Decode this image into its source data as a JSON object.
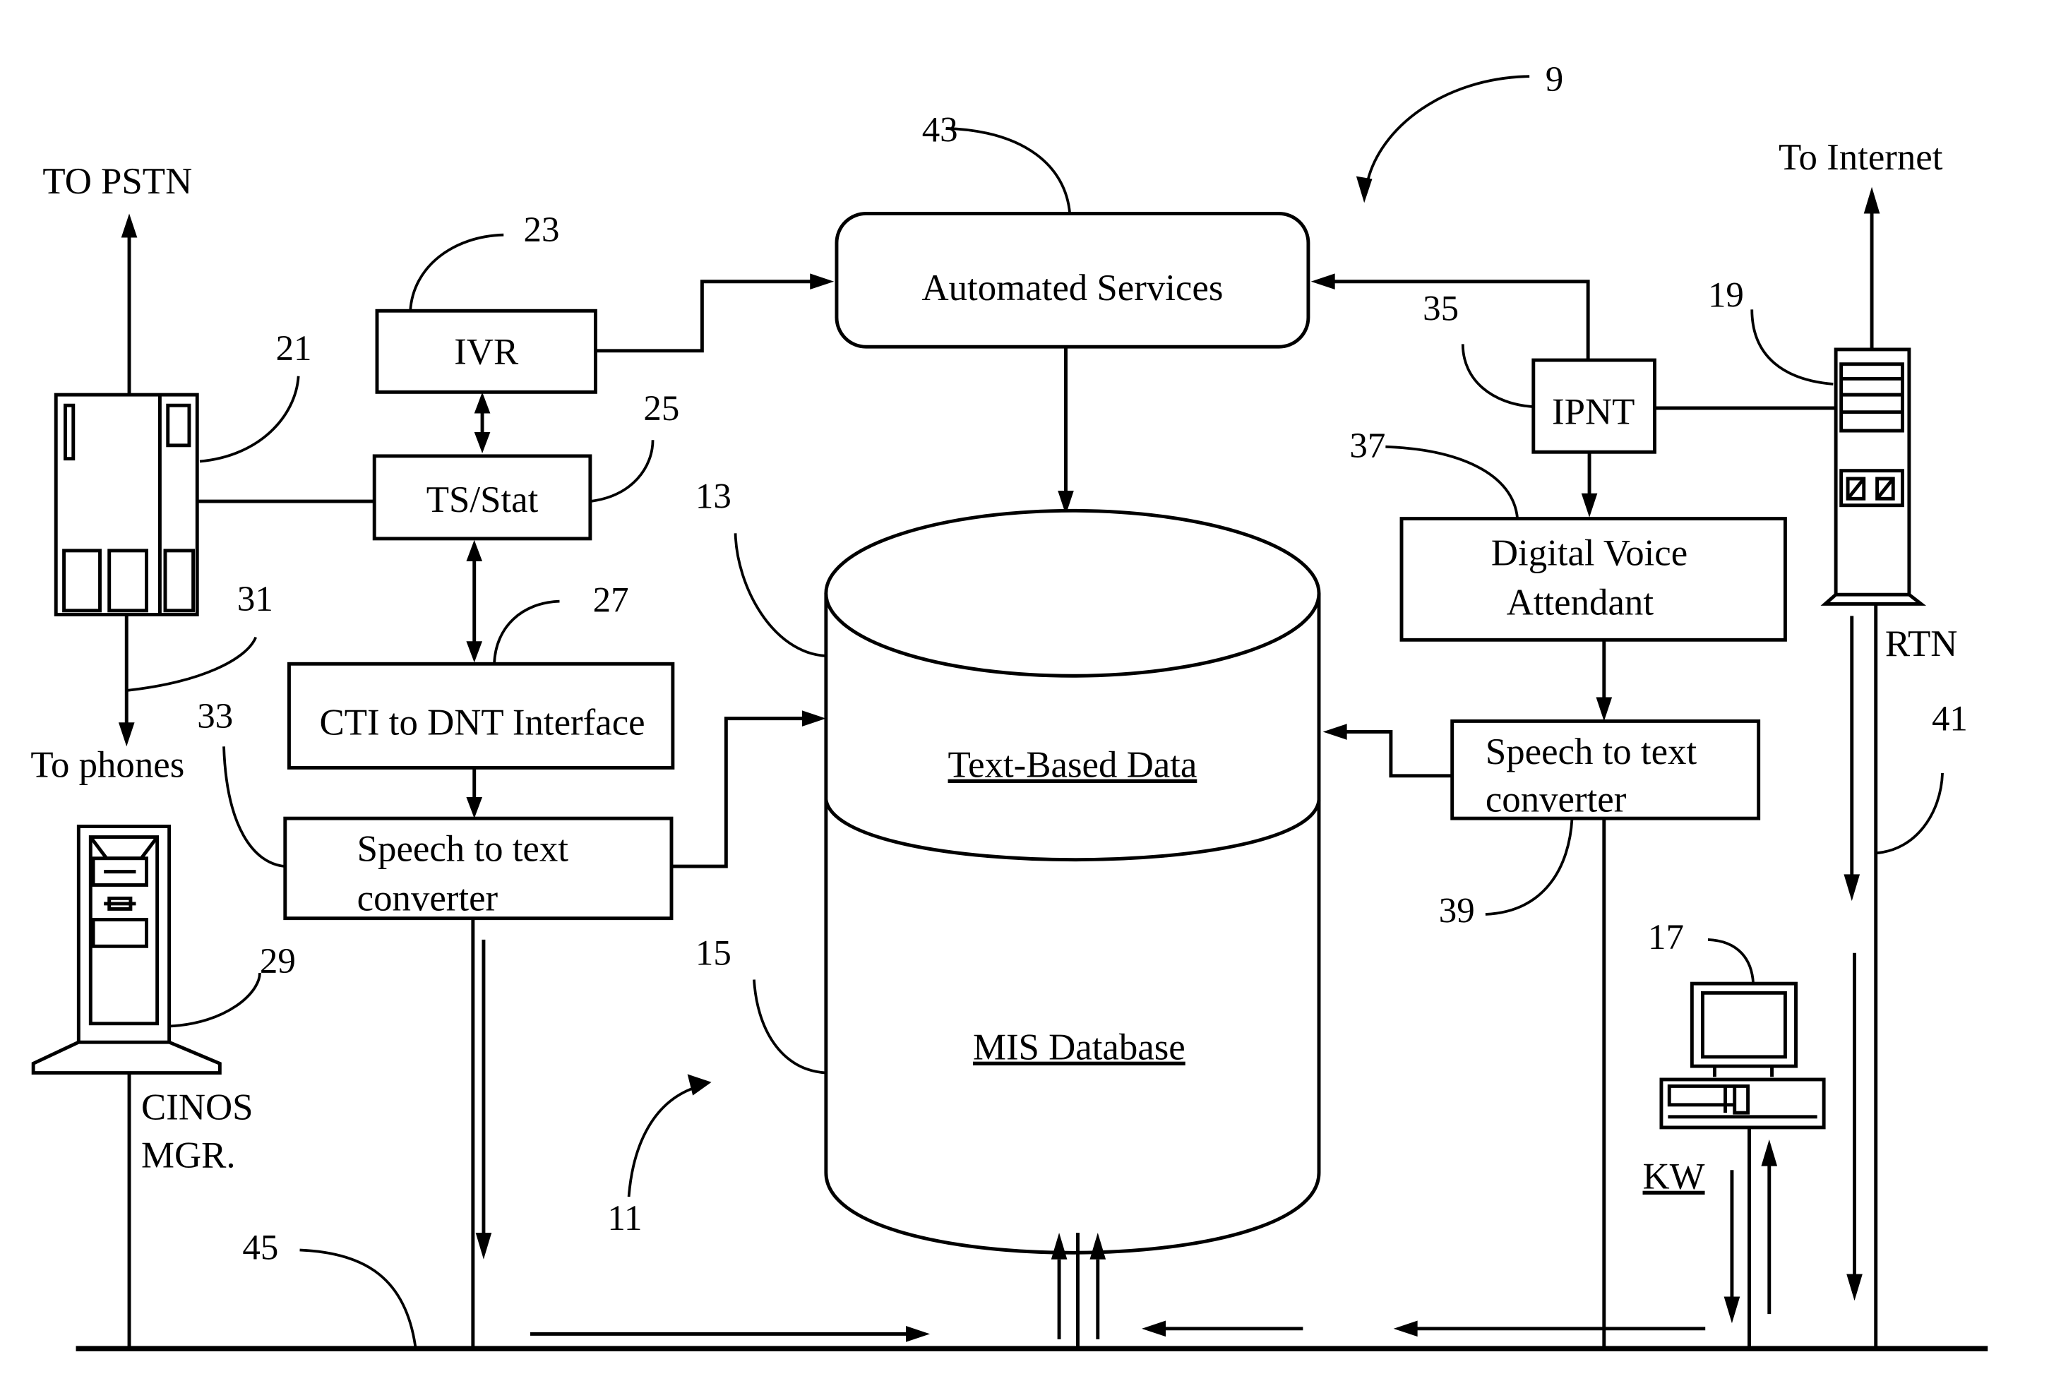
{
  "figure": {
    "system_ref": "9",
    "db_group_ref": "11"
  },
  "external": {
    "pstn": "TO PSTN",
    "phones": "To phones",
    "internet": "To Internet",
    "rtn": "RTN"
  },
  "components": {
    "ivr": {
      "label": "IVR",
      "ref": "23"
    },
    "ts_stat": {
      "label": "TS/Stat",
      "ref": "25"
    },
    "cti": {
      "label": "CTI to DNT Interface",
      "ref": "27"
    },
    "stt_left": {
      "line1": "Speech to text",
      "line2": "converter",
      "ref": "33"
    },
    "automated_services": {
      "label": "Automated Services",
      "ref": "43"
    },
    "ipnt": {
      "label": "IPNT",
      "ref": "35"
    },
    "dva": {
      "line1": "Digital Voice",
      "line2": "Attendant",
      "ref": "37"
    },
    "stt_right": {
      "line1": "Speech to text",
      "line2": "converter",
      "ref": "39"
    },
    "switch": {
      "ref": "21",
      "line_ref": "31"
    },
    "router": {
      "ref": "19"
    },
    "cinos_manager": {
      "line1": "CINOS",
      "line2": "MGR.",
      "ref": "29"
    },
    "workstation": {
      "label": "KW",
      "ref": "17"
    },
    "lan": {
      "ref": "45"
    },
    "rtn_line": {
      "ref": "41"
    }
  },
  "database": {
    "text_section": {
      "label": "Text-Based Data",
      "ref": "13"
    },
    "mis_section": {
      "label": "MIS Database",
      "ref": "15"
    }
  }
}
